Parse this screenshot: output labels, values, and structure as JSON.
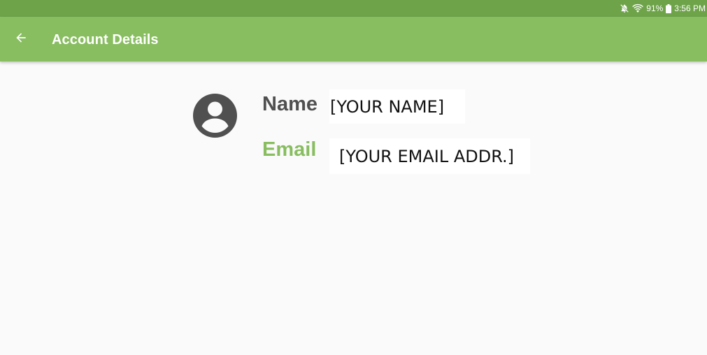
{
  "status_bar": {
    "battery": "91%",
    "time": "3:56 PM",
    "icons": [
      "mute-icon",
      "wifi-icon",
      "battery-icon"
    ]
  },
  "app_bar": {
    "title": "Account Details",
    "back_icon": "arrow-left-icon"
  },
  "account": {
    "avatar_icon": "account-circle-icon",
    "name_label": "Name",
    "name_value": "[YOUR NAME]",
    "email_label": "Email",
    "email_value": "[YOUR EMAIL ADDR.]"
  },
  "colors": {
    "status_bar": "#6ea34a",
    "app_bar": "#88bd60",
    "accent": "#88bd60",
    "label_text": "#505050",
    "background": "#fafafa"
  }
}
